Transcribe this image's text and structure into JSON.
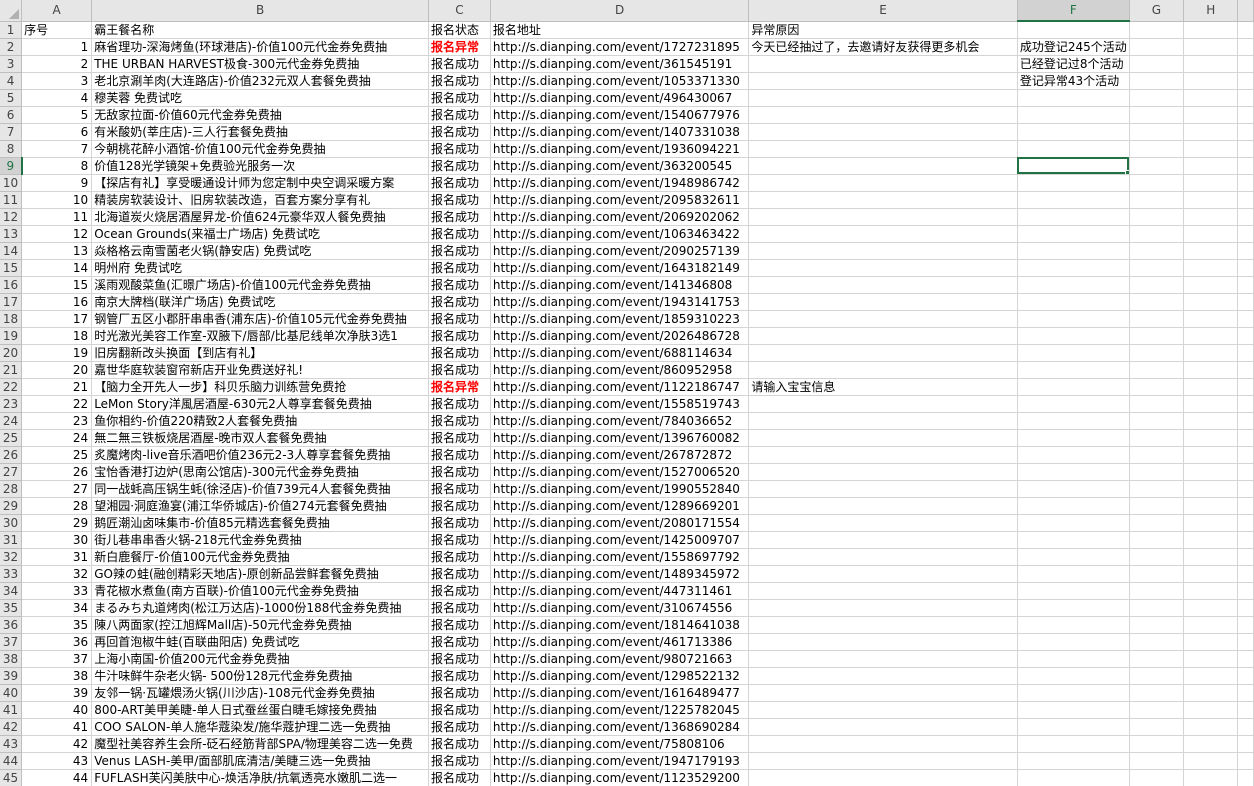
{
  "columns": [
    "A",
    "B",
    "C",
    "D",
    "E",
    "F",
    "G",
    "H"
  ],
  "selected_column": "F",
  "selected_row": 9,
  "header_row": {
    "a": "序号",
    "b": "霸王餐名称",
    "c": "报名状态",
    "d": "报名地址",
    "e": "异常原因"
  },
  "rows": [
    {
      "a": "1",
      "b": "麻省理功-深海烤鱼(环球港店)-价值100元代金券免费抽",
      "c": "报名异常",
      "d": "http://s.dianping.com/event/1727231895",
      "e": "今天已经抽过了，去邀请好友获得更多机会",
      "f": "成功登记245个活动",
      "status_color": "#ff0000"
    },
    {
      "a": "2",
      "b": "THE URBAN HARVEST极食-300元代金券免费抽",
      "c": "报名成功",
      "d": "http://s.dianping.com/event/361545191",
      "e": "",
      "f": "已经登记过8个活动"
    },
    {
      "a": "3",
      "b": "老北京涮羊肉(大连路店)-价值232元双人套餐免费抽",
      "c": "报名成功",
      "d": "http://s.dianping.com/event/1053371330",
      "e": "",
      "f": "登记异常43个活动"
    },
    {
      "a": "4",
      "b": "穆芙蓉 免费试吃",
      "c": "报名成功",
      "d": "http://s.dianping.com/event/496430067",
      "e": "",
      "f": ""
    },
    {
      "a": "5",
      "b": "无敌家拉面-价值60元代金券免费抽",
      "c": "报名成功",
      "d": "http://s.dianping.com/event/1540677976",
      "e": "",
      "f": ""
    },
    {
      "a": "6",
      "b": "有米酸奶(莘庄店)-三人行套餐免费抽",
      "c": "报名成功",
      "d": "http://s.dianping.com/event/1407331038",
      "e": "",
      "f": ""
    },
    {
      "a": "7",
      "b": "今朝桃花醉小酒馆-价值100元代金券免费抽",
      "c": "报名成功",
      "d": "http://s.dianping.com/event/1936094221",
      "e": "",
      "f": ""
    },
    {
      "a": "8",
      "b": "价值128光学镜架+免费验光服务一次",
      "c": "报名成功",
      "d": "http://s.dianping.com/event/363200545",
      "e": "",
      "f": ""
    },
    {
      "a": "9",
      "b": "【探店有礼】享受暖通设计师为您定制中央空调采暖方案",
      "c": "报名成功",
      "d": "http://s.dianping.com/event/1948986742",
      "e": "",
      "f": ""
    },
    {
      "a": "10",
      "b": "精装房软装设计、旧房软装改造，百套方案分享有礼",
      "c": "报名成功",
      "d": "http://s.dianping.com/event/2095832611",
      "e": "",
      "f": ""
    },
    {
      "a": "11",
      "b": "北海道炭火烧居酒屋昇龙-价值624元豪华双人餐免费抽",
      "c": "报名成功",
      "d": "http://s.dianping.com/event/2069202062",
      "e": "",
      "f": ""
    },
    {
      "a": "12",
      "b": "Ocean Grounds(来福士广场店) 免费试吃",
      "c": "报名成功",
      "d": "http://s.dianping.com/event/1063463422",
      "e": "",
      "f": ""
    },
    {
      "a": "13",
      "b": "焱格格云南雪菌老火锅(静安店) 免费试吃",
      "c": "报名成功",
      "d": "http://s.dianping.com/event/2090257139",
      "e": "",
      "f": ""
    },
    {
      "a": "14",
      "b": "明州府 免费试吃",
      "c": "报名成功",
      "d": "http://s.dianping.com/event/1643182149",
      "e": "",
      "f": ""
    },
    {
      "a": "15",
      "b": "溪雨观酸菜鱼(汇暻广场店)-价值100元代金券免费抽",
      "c": "报名成功",
      "d": "http://s.dianping.com/event/141346808",
      "e": "",
      "f": ""
    },
    {
      "a": "16",
      "b": "南京大牌档(联洋广场店) 免费试吃",
      "c": "报名成功",
      "d": "http://s.dianping.com/event/1943141753",
      "e": "",
      "f": ""
    },
    {
      "a": "17",
      "b": "钢管厂五区小郡肝串串香(浦东店)-价值105元代金券免费抽",
      "c": "报名成功",
      "d": "http://s.dianping.com/event/1859310223",
      "e": "",
      "f": ""
    },
    {
      "a": "18",
      "b": "时光激光美容工作室-双腋下/唇部/比基尼线单次净肤3选1",
      "c": "报名成功",
      "d": "http://s.dianping.com/event/2026486728",
      "e": "",
      "f": ""
    },
    {
      "a": "19",
      "b": "旧房翻新改头换面【到店有礼】",
      "c": "报名成功",
      "d": "http://s.dianping.com/event/688114634",
      "e": "",
      "f": ""
    },
    {
      "a": "20",
      "b": "嘉世华庭软装窗帘新店开业免费送好礼!",
      "c": "报名成功",
      "d": "http://s.dianping.com/event/860952958",
      "e": "",
      "f": ""
    },
    {
      "a": "21",
      "b": "【脑力全开先人一步】科贝乐脑力训练营免费抢",
      "c": "报名异常",
      "d": "http://s.dianping.com/event/1122186747",
      "e": "请输入宝宝信息",
      "f": "",
      "status_color": "#ff0000"
    },
    {
      "a": "22",
      "b": "LeMon Story洋風居酒屋-630元2人尊享套餐免费抽",
      "c": "报名成功",
      "d": "http://s.dianping.com/event/1558519743",
      "e": "",
      "f": ""
    },
    {
      "a": "23",
      "b": "鱼你相约-价值220精致2人套餐免费抽",
      "c": "报名成功",
      "d": "http://s.dianping.com/event/784036652",
      "e": "",
      "f": ""
    },
    {
      "a": "24",
      "b": "無二無三铁板烧居酒屋-晚市双人套餐免费抽",
      "c": "报名成功",
      "d": "http://s.dianping.com/event/1396760082",
      "e": "",
      "f": ""
    },
    {
      "a": "25",
      "b": "炙魔烤肉-live音乐酒吧价值236元2-3人尊享套餐免费抽",
      "c": "报名成功",
      "d": "http://s.dianping.com/event/267872872",
      "e": "",
      "f": ""
    },
    {
      "a": "26",
      "b": "宝怡香港打边炉(思南公馆店)-300元代金券免费抽",
      "c": "报名成功",
      "d": "http://s.dianping.com/event/1527006520",
      "e": "",
      "f": ""
    },
    {
      "a": "27",
      "b": "同一战蚝高压锅生蚝(徐泾店)-价值739元4人套餐免费抽",
      "c": "报名成功",
      "d": "http://s.dianping.com/event/1990552840",
      "e": "",
      "f": ""
    },
    {
      "a": "28",
      "b": "望湘园·洞庭渔宴(浦江华侨城店)-价值274元套餐免费抽",
      "c": "报名成功",
      "d": "http://s.dianping.com/event/1289669201",
      "e": "",
      "f": ""
    },
    {
      "a": "29",
      "b": "鹅匠潮汕卤味集市-价值85元精选套餐免费抽",
      "c": "报名成功",
      "d": "http://s.dianping.com/event/2080171554",
      "e": "",
      "f": ""
    },
    {
      "a": "30",
      "b": "街儿巷串串香火锅-218元代金券免费抽",
      "c": "报名成功",
      "d": "http://s.dianping.com/event/1425009707",
      "e": "",
      "f": ""
    },
    {
      "a": "31",
      "b": "新白鹿餐厅-价值100元代金券免费抽",
      "c": "报名成功",
      "d": "http://s.dianping.com/event/1558697792",
      "e": "",
      "f": ""
    },
    {
      "a": "32",
      "b": "GO辣の蛙(融创精彩天地店)-原创新品尝鲜套餐免费抽",
      "c": "报名成功",
      "d": "http://s.dianping.com/event/1489345972",
      "e": "",
      "f": ""
    },
    {
      "a": "33",
      "b": "青花椒水煮鱼(南方百联)-价值100元代金券免费抽",
      "c": "报名成功",
      "d": "http://s.dianping.com/event/447311461",
      "e": "",
      "f": ""
    },
    {
      "a": "34",
      "b": "まるみち丸道烤肉(松江万达店)-1000份188代金券免费抽",
      "c": "报名成功",
      "d": "http://s.dianping.com/event/310674556",
      "e": "",
      "f": ""
    },
    {
      "a": "35",
      "b": "陳八两面家(控江旭辉Mall店)-50元代金券免费抽",
      "c": "报名成功",
      "d": "http://s.dianping.com/event/1814641038",
      "e": "",
      "f": ""
    },
    {
      "a": "36",
      "b": "再回首泡椒牛蛙(百联曲阳店) 免费试吃",
      "c": "报名成功",
      "d": "http://s.dianping.com/event/461713386",
      "e": "",
      "f": ""
    },
    {
      "a": "37",
      "b": "上海小南国-价值200元代金券免费抽",
      "c": "报名成功",
      "d": "http://s.dianping.com/event/980721663",
      "e": "",
      "f": ""
    },
    {
      "a": "38",
      "b": "牛汁味鲜牛杂老火锅- 500份128元代金券免费抽",
      "c": "报名成功",
      "d": "http://s.dianping.com/event/1298522132",
      "e": "",
      "f": ""
    },
    {
      "a": "39",
      "b": "友邻一锅·瓦罐煨汤火锅(川沙店)-108元代金券免费抽",
      "c": "报名成功",
      "d": "http://s.dianping.com/event/1616489477",
      "e": "",
      "f": ""
    },
    {
      "a": "40",
      "b": "800-ART美甲美睫-单人日式蚕丝蛋白睫毛嫁接免费抽",
      "c": "报名成功",
      "d": "http://s.dianping.com/event/1225782045",
      "e": "",
      "f": ""
    },
    {
      "a": "41",
      "b": "COO SALON-单人施华蔻染发/施华蔻护理二选一免费抽",
      "c": "报名成功",
      "d": "http://s.dianping.com/event/1368690284",
      "e": "",
      "f": ""
    },
    {
      "a": "42",
      "b": "魔型社美容养生会所-砭石经筋背部SPA/物理美容二选一免费",
      "c": "报名成功",
      "d": "http://s.dianping.com/event/75808106",
      "e": "",
      "f": ""
    },
    {
      "a": "43",
      "b": "Venus LASH-美甲/面部肌底清洁/美睫三选一免费抽",
      "c": "报名成功",
      "d": "http://s.dianping.com/event/1947179193",
      "e": "",
      "f": ""
    },
    {
      "a": "44",
      "b": "FUFLASH芙闪美肤中心-焕活净肤/抗氧透亮水嫩肌二选一",
      "c": "报名成功",
      "d": "http://s.dianping.com/event/1123529200",
      "e": "",
      "f": ""
    }
  ]
}
